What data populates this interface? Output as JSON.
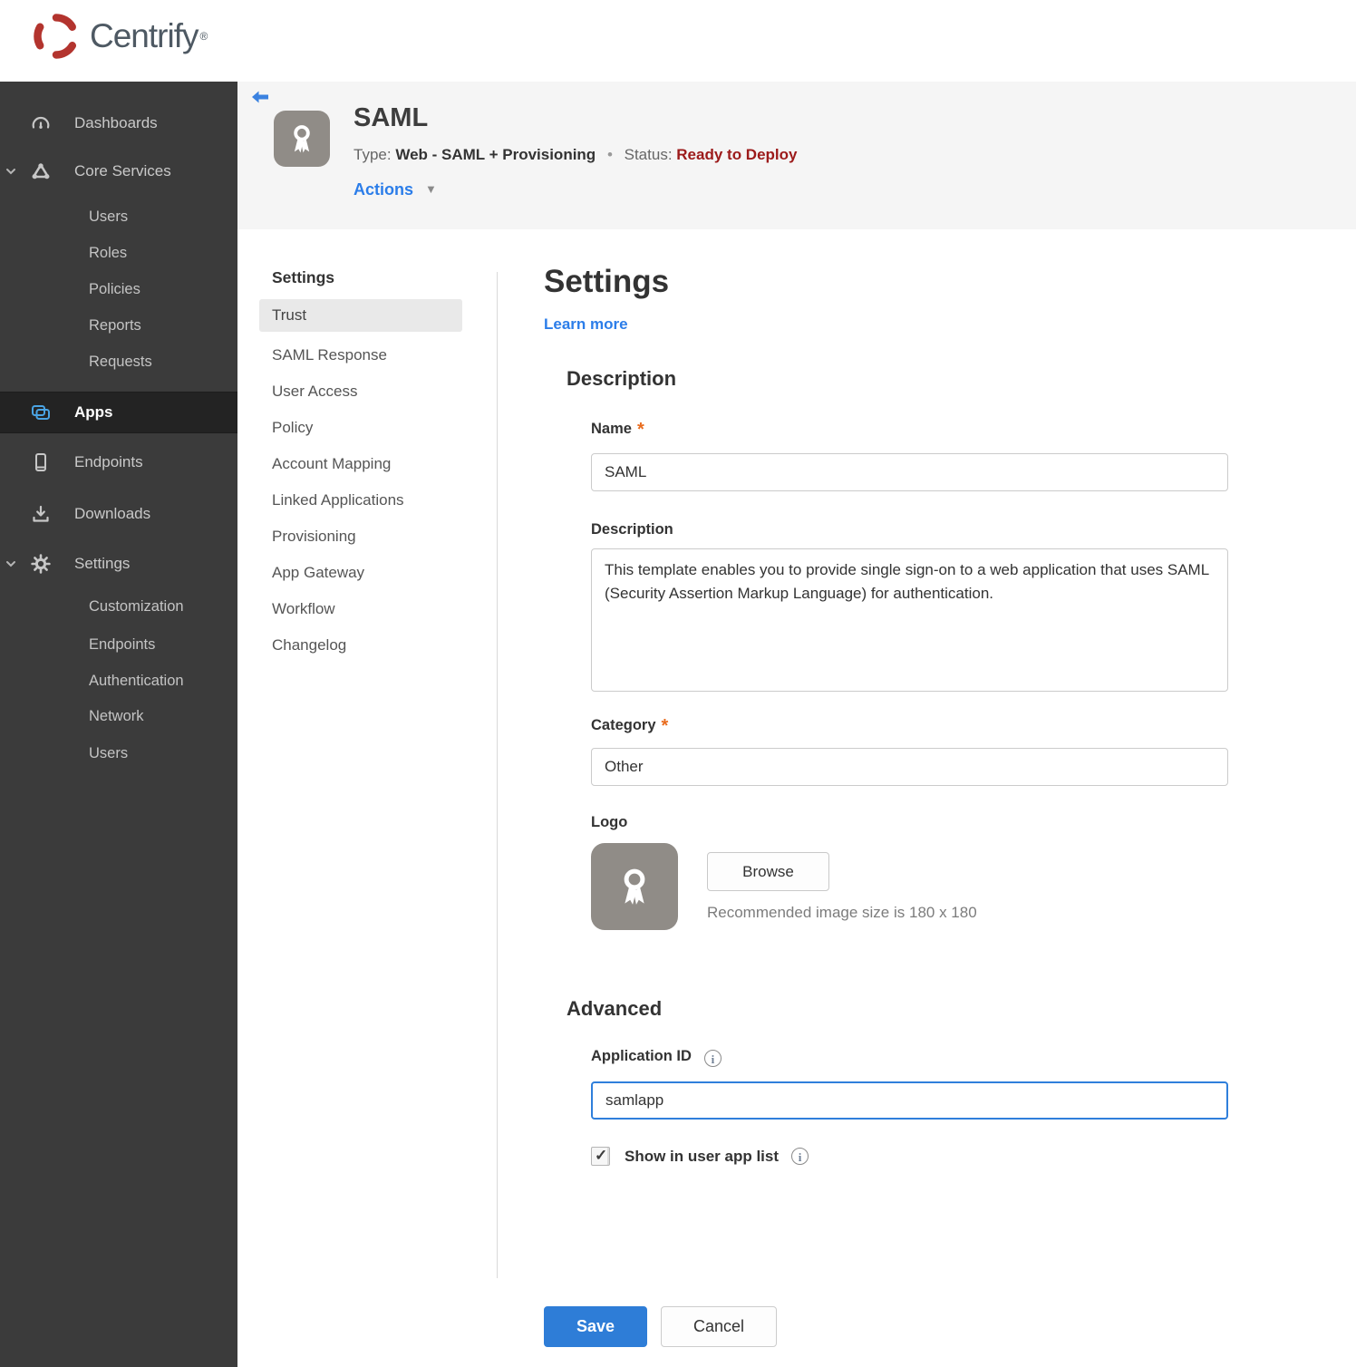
{
  "brand": {
    "name": "Centrify",
    "registered_mark": "®"
  },
  "sidebar": {
    "dashboards": "Dashboards",
    "core_services": "Core Services",
    "core_children": [
      "Users",
      "Roles",
      "Policies",
      "Reports",
      "Requests"
    ],
    "apps": "Apps",
    "endpoints": "Endpoints",
    "downloads": "Downloads",
    "settings": "Settings",
    "settings_children": [
      "Customization",
      "Endpoints",
      "Authentication",
      "Network",
      "Users"
    ]
  },
  "header": {
    "app_title": "SAML",
    "type_label": "Type:",
    "type_value": "Web - SAML + Provisioning",
    "separator": "•",
    "status_label": "Status:",
    "status_value": "Ready to Deploy",
    "actions_label": "Actions"
  },
  "subnav": {
    "heading": "Settings",
    "items": [
      "Trust",
      "SAML Response",
      "User Access",
      "Policy",
      "Account Mapping",
      "Linked Applications",
      "Provisioning",
      "App Gateway",
      "Workflow",
      "Changelog"
    ],
    "selected_item": "Trust"
  },
  "main": {
    "title": "Settings",
    "learn_more_label": "Learn more",
    "description": {
      "heading": "Description",
      "name_label": "Name",
      "required_mark": "*",
      "name_value": "SAML",
      "description_label": "Description",
      "description_value": "This template enables you to provide single sign-on to a web application that uses SAML (Security Assertion Markup Language) for authentication.",
      "category_label": "Category",
      "category_value": "Other",
      "logo_label": "Logo",
      "browse_label": "Browse",
      "recommended_text": "Recommended image size is 180 x 180"
    },
    "advanced": {
      "heading": "Advanced",
      "application_id_label": "Application ID",
      "application_id_value": "samlapp",
      "show_in_user_app_list_label": "Show in user app list",
      "show_in_user_app_list_checked": true
    },
    "actions": {
      "save_label": "Save",
      "cancel_label": "Cancel"
    }
  },
  "colors": {
    "accent_blue": "#2e7dd7",
    "link_blue": "#2b7de9",
    "apps_icon_blue": "#4aa4e4",
    "status_red": "#9c1a1a",
    "required_orange": "#e96c1e",
    "sidebar_bg": "#3b3b3b",
    "sidebar_selected_bg": "#232323",
    "header_band_bg": "#f5f5f5",
    "brand_red": "#b3342e"
  }
}
